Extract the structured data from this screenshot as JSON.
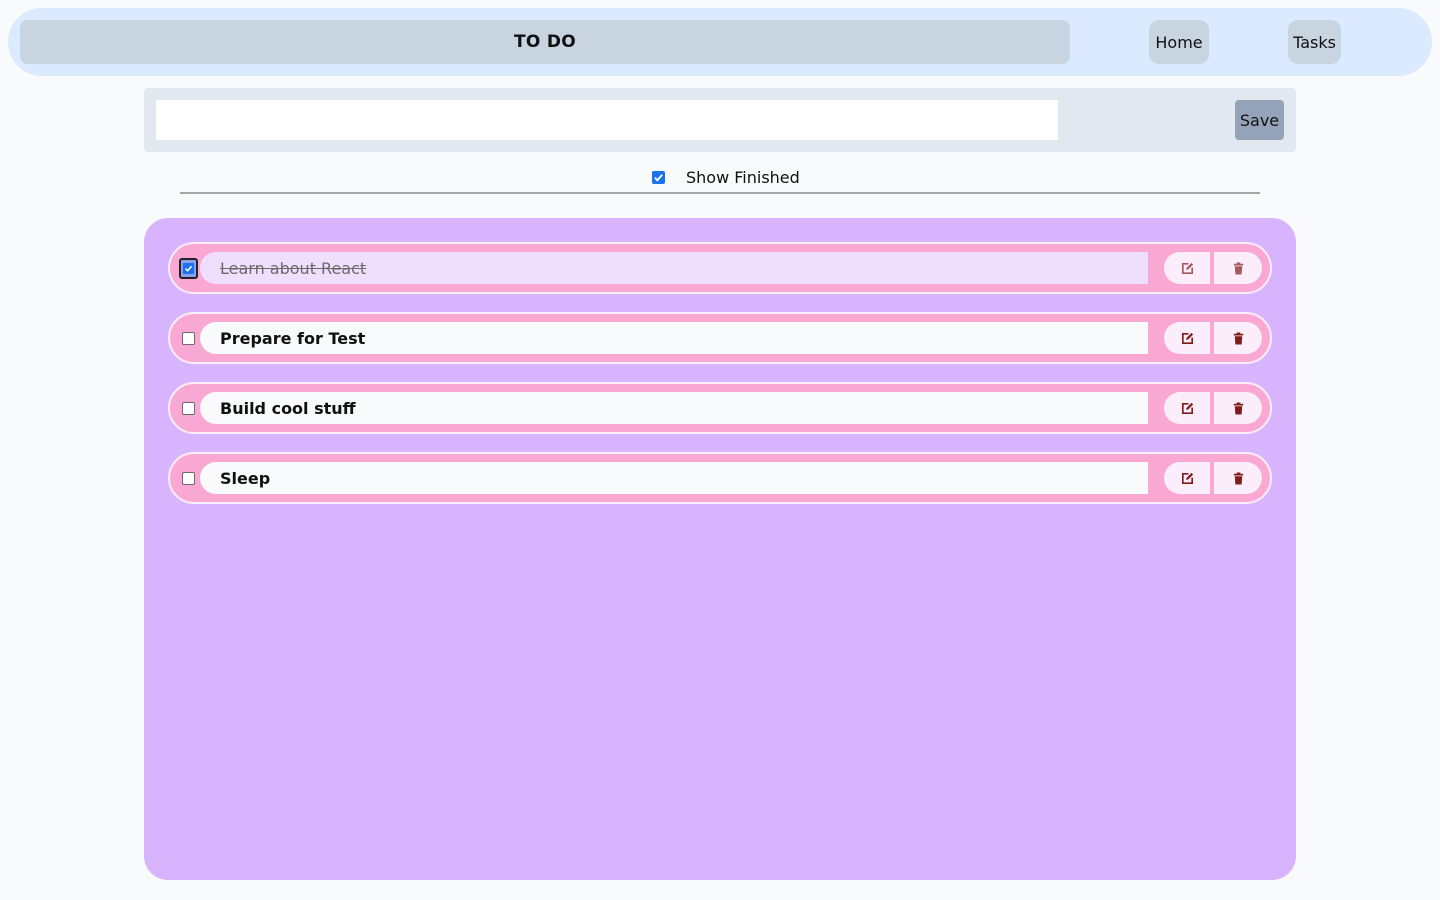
{
  "header": {
    "title": "TO DO",
    "nav": [
      {
        "label": "Home"
      },
      {
        "label": "Tasks"
      }
    ]
  },
  "entry": {
    "value": "",
    "placeholder": "",
    "save_label": "Save"
  },
  "filter": {
    "show_finished_label": "Show Finished",
    "show_finished_checked": true
  },
  "tasks": [
    {
      "text": "Learn about React",
      "done": true
    },
    {
      "text": "Prepare for Test",
      "done": false
    },
    {
      "text": "Build cool stuff",
      "done": false
    },
    {
      "text": "Sleep",
      "done": false
    }
  ],
  "icons": {
    "edit": "edit-icon",
    "delete": "trash-icon",
    "check": "checkmark-icon"
  },
  "colors": {
    "accent": "#1a73e8",
    "icon": "#7f1d1d",
    "panel": "#d8b4fe",
    "row": "#f9a8d4"
  }
}
